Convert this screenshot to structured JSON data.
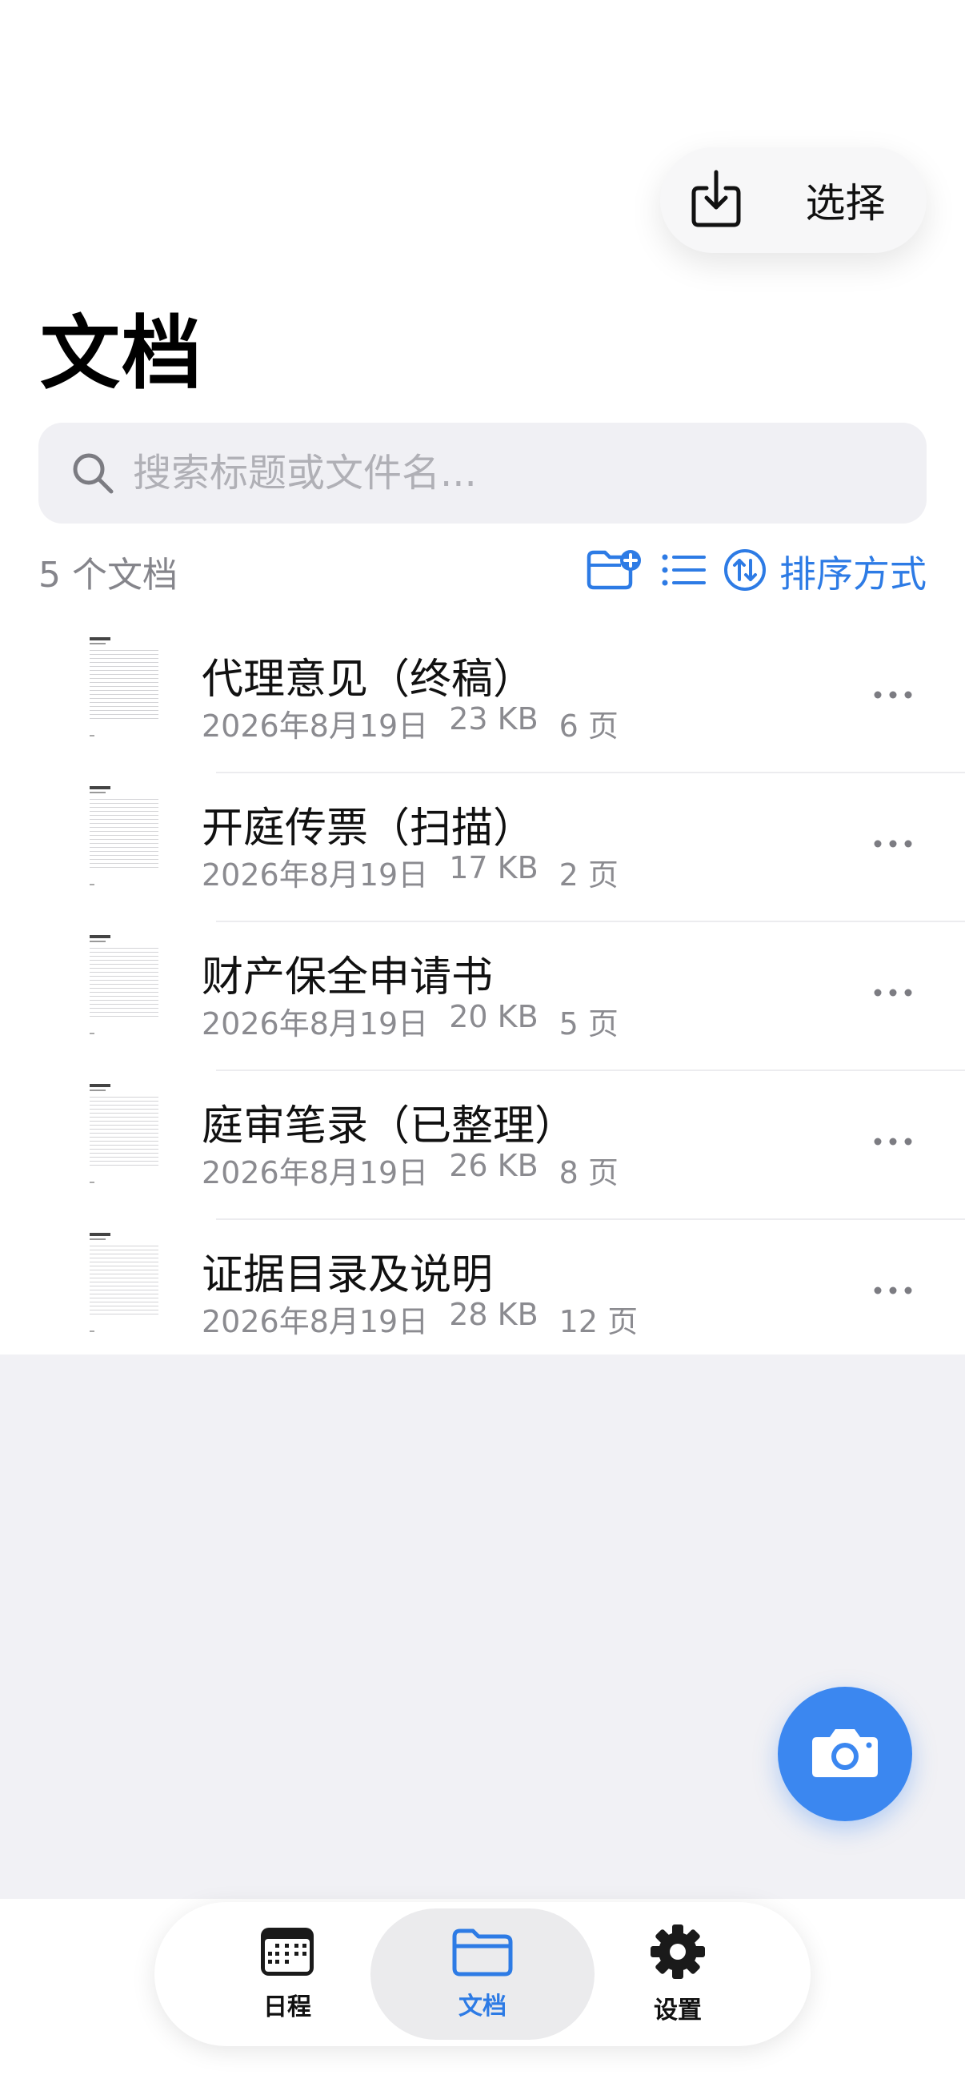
{
  "header": {
    "title": "文档",
    "select_label": "选择",
    "import_icon": "tray-arrow-down-icon"
  },
  "search": {
    "placeholder": "搜索标题或文件名..."
  },
  "toolbar": {
    "count": "5 个文档",
    "sort_label": "排序方式"
  },
  "documents": [
    {
      "title": "代理意见（终稿）",
      "date": "2026年8月19日",
      "size": "23 KB",
      "pages": "6 页"
    },
    {
      "title": "开庭传票（扫描）",
      "date": "2026年8月19日",
      "size": "17 KB",
      "pages": "2 页"
    },
    {
      "title": "财产保全申请书",
      "date": "2026年8月19日",
      "size": "20 KB",
      "pages": "5 页"
    },
    {
      "title": "庭审笔录（已整理）",
      "date": "2026年8月19日",
      "size": "26 KB",
      "pages": "8 页"
    },
    {
      "title": "证据目录及说明",
      "date": "2026年8月19日",
      "size": "28 KB",
      "pages": "12 页"
    }
  ],
  "tabs": [
    {
      "label": "日程",
      "icon": "calendar-icon"
    },
    {
      "label": "文档",
      "icon": "folder-icon"
    },
    {
      "label": "设置",
      "icon": "gear-icon"
    }
  ],
  "colors": {
    "accent": "#2d7be5",
    "fab": "#3b87f0",
    "background_gray": "#f1f1f5"
  }
}
